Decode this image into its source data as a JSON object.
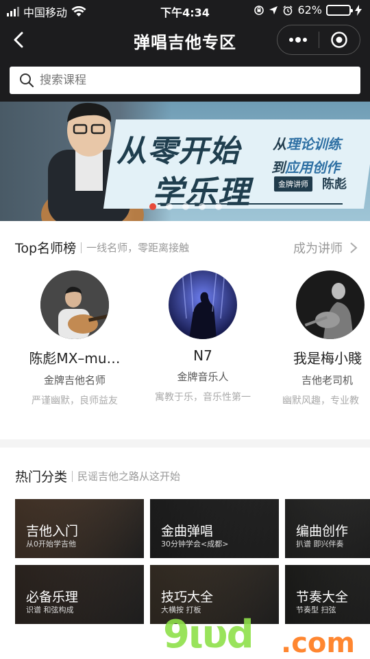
{
  "status_bar": {
    "carrier": "中国移动",
    "time": "下午4:34",
    "battery_percent": "62%",
    "battery_level": 0.62
  },
  "nav": {
    "title": "弹唱吉他专区",
    "back_icon": "chevron-left-icon",
    "more_icon": "more-dots-icon",
    "close_icon": "target-circle-icon"
  },
  "search": {
    "placeholder": "搜索课程"
  },
  "banner": {
    "headline_1": "从零开始",
    "headline_2": "学乐理",
    "sub_1_prefix": "从",
    "sub_1_highlight": "理论训练",
    "sub_2_prefix": "到",
    "sub_2_highlight": "应用创作",
    "badge": "金牌讲师",
    "name": "陈彪",
    "page_count": 5,
    "active_page": 0
  },
  "teachers": {
    "title": "Top名师榜",
    "subtitle": "一线名师，零距离接触",
    "become_label": "成为讲师",
    "items": [
      {
        "name": "陈彪MX–mu…",
        "title": "金牌吉他名师",
        "desc": "严谨幽默，良师益友"
      },
      {
        "name": "N7",
        "title": "金牌音乐人",
        "desc": "寓教于乐，音乐性第一"
      },
      {
        "name": "我是梅小賤",
        "title": "吉他老司机",
        "desc": "幽默风趣，专业教"
      }
    ]
  },
  "categories": {
    "title": "热门分类",
    "subtitle": "民谣吉他之路从这开始",
    "items": [
      {
        "label": "吉他入门",
        "sub": "从0开始学吉他",
        "color": "#8a6a52"
      },
      {
        "label": "金曲弹唱",
        "sub": "30分钟学会<成都>",
        "color": "#3c3c3c"
      },
      {
        "label": "编曲创作",
        "sub": "扒谱 即兴伴奏",
        "color": "#4a4a48"
      },
      {
        "label": "必备乐理",
        "sub": "识谱 和弦构成",
        "color": "#5a4a40"
      },
      {
        "label": "技巧大全",
        "sub": "大横按 打板",
        "color": "#6a5a48"
      },
      {
        "label": "节奏大全",
        "sub": "节奏型 扫弦",
        "color": "#3a3a36"
      }
    ]
  },
  "watermark": {
    "text_1": "9ιυd",
    "text_2": ".com"
  }
}
